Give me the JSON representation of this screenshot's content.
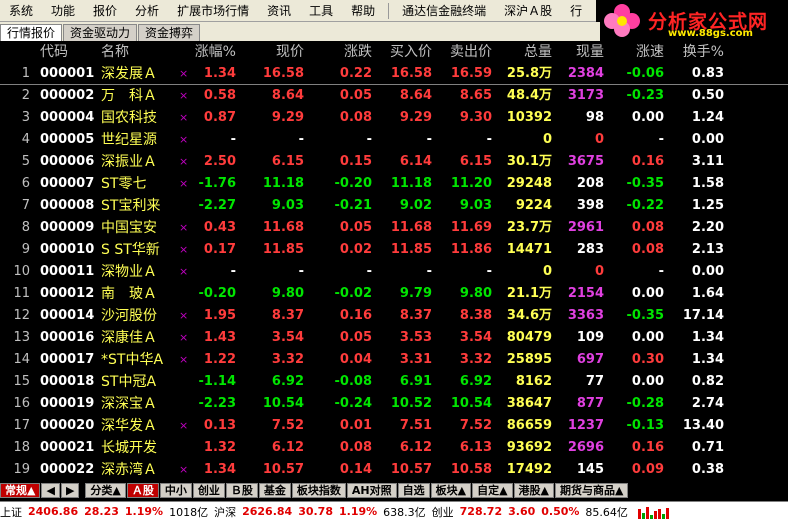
{
  "menu": {
    "items": [
      "系统",
      "功能",
      "报价",
      "分析",
      "扩展市场行情",
      "资讯",
      "工具",
      "帮助",
      "通达信金融终端",
      "深沪Ａ股",
      "行"
    ]
  },
  "logo": {
    "title": "分析家公式网",
    "url": "www.88gs.com"
  },
  "tabs": [
    "行情报价",
    "资金驱动力",
    "资金搏弈"
  ],
  "table": {
    "headers": {
      "code": "代码",
      "name": "名称",
      "pct": "涨幅%",
      "price": "现价",
      "chg": "涨跌",
      "bid": "买入价",
      "ask": "卖出价",
      "vol": "总量",
      "cur": "现量",
      "spd": "涨速",
      "turn": "换手%"
    },
    "rows": [
      {
        "idx": "1",
        "code": "000001",
        "name": "深发展Ａ",
        "mark": "×",
        "pct": "1.34",
        "price": "16.58",
        "chg": "0.22",
        "bid": "16.58",
        "ask": "16.59",
        "vol": "25.8万",
        "cur": "2384",
        "spd": "-0.06",
        "turn": "0.83",
        "dir": "up",
        "curc": "magenta",
        "spdd": "down"
      },
      {
        "idx": "2",
        "code": "000002",
        "name": "万　科Ａ",
        "mark": "×",
        "pct": "0.58",
        "price": "8.64",
        "chg": "0.05",
        "bid": "8.64",
        "ask": "8.65",
        "vol": "48.4万",
        "cur": "3173",
        "spd": "-0.23",
        "turn": "0.50",
        "dir": "up",
        "curc": "magenta",
        "spdd": "down"
      },
      {
        "idx": "3",
        "code": "000004",
        "name": "国农科技",
        "mark": "×",
        "pct": "0.87",
        "price": "9.29",
        "chg": "0.08",
        "bid": "9.29",
        "ask": "9.30",
        "vol": "10392",
        "cur": "98",
        "spd": "0.00",
        "turn": "1.24",
        "dir": "up",
        "curc": "white",
        "spdd": "flat"
      },
      {
        "idx": "4",
        "code": "000005",
        "name": "世纪星源",
        "mark": "×",
        "pct": "-",
        "price": "-",
        "chg": "-",
        "bid": "-",
        "ask": "-",
        "vol": "0",
        "cur": "0",
        "spd": "-",
        "turn": "0.00",
        "dir": "flat",
        "curc": "up",
        "spdd": "flat"
      },
      {
        "idx": "5",
        "code": "000006",
        "name": "深振业Ａ",
        "mark": "×",
        "pct": "2.50",
        "price": "6.15",
        "chg": "0.15",
        "bid": "6.14",
        "ask": "6.15",
        "vol": "30.1万",
        "cur": "3675",
        "spd": "0.16",
        "turn": "3.11",
        "dir": "up",
        "curc": "magenta",
        "spdd": "up"
      },
      {
        "idx": "6",
        "code": "000007",
        "name": "ST零七",
        "mark": "×",
        "pct": "-1.76",
        "price": "11.18",
        "chg": "-0.20",
        "bid": "11.18",
        "ask": "11.20",
        "vol": "29248",
        "cur": "208",
        "spd": "-0.35",
        "turn": "1.58",
        "dir": "down",
        "curc": "white",
        "spdd": "down"
      },
      {
        "idx": "7",
        "code": "000008",
        "name": "ST宝利来",
        "mark": "",
        "pct": "-2.27",
        "price": "9.03",
        "chg": "-0.21",
        "bid": "9.02",
        "ask": "9.03",
        "vol": "9224",
        "cur": "398",
        "spd": "-0.22",
        "turn": "1.25",
        "dir": "down",
        "curc": "white",
        "spdd": "down"
      },
      {
        "idx": "8",
        "code": "000009",
        "name": "中国宝安",
        "mark": "×",
        "pct": "0.43",
        "price": "11.68",
        "chg": "0.05",
        "bid": "11.68",
        "ask": "11.69",
        "vol": "23.7万",
        "cur": "2961",
        "spd": "0.08",
        "turn": "2.20",
        "dir": "up",
        "curc": "magenta",
        "spdd": "up"
      },
      {
        "idx": "9",
        "code": "000010",
        "name": "S ST华新",
        "mark": "×",
        "pct": "0.17",
        "price": "11.85",
        "chg": "0.02",
        "bid": "11.85",
        "ask": "11.86",
        "vol": "14471",
        "cur": "283",
        "spd": "0.08",
        "turn": "2.13",
        "dir": "up",
        "curc": "white",
        "spdd": "up"
      },
      {
        "idx": "10",
        "code": "000011",
        "name": "深物业Ａ",
        "mark": "×",
        "pct": "-",
        "price": "-",
        "chg": "-",
        "bid": "-",
        "ask": "-",
        "vol": "0",
        "cur": "0",
        "spd": "-",
        "turn": "0.00",
        "dir": "flat",
        "curc": "up",
        "spdd": "flat"
      },
      {
        "idx": "11",
        "code": "000012",
        "name": "南　玻Ａ",
        "mark": "",
        "pct": "-0.20",
        "price": "9.80",
        "chg": "-0.02",
        "bid": "9.79",
        "ask": "9.80",
        "vol": "21.1万",
        "cur": "2154",
        "spd": "0.00",
        "turn": "1.64",
        "dir": "down",
        "curc": "magenta",
        "spdd": "flat"
      },
      {
        "idx": "12",
        "code": "000014",
        "name": "沙河股份",
        "mark": "×",
        "pct": "1.95",
        "price": "8.37",
        "chg": "0.16",
        "bid": "8.37",
        "ask": "8.38",
        "vol": "34.6万",
        "cur": "3363",
        "spd": "-0.35",
        "turn": "17.14",
        "dir": "up",
        "curc": "magenta",
        "spdd": "down"
      },
      {
        "idx": "13",
        "code": "000016",
        "name": "深康佳Ａ",
        "mark": "×",
        "pct": "1.43",
        "price": "3.54",
        "chg": "0.05",
        "bid": "3.53",
        "ask": "3.54",
        "vol": "80479",
        "cur": "109",
        "spd": "0.00",
        "turn": "1.34",
        "dir": "up",
        "curc": "white",
        "spdd": "flat"
      },
      {
        "idx": "14",
        "code": "000017",
        "name": "*ST中华A",
        "mark": "×",
        "pct": "1.22",
        "price": "3.32",
        "chg": "0.04",
        "bid": "3.31",
        "ask": "3.32",
        "vol": "25895",
        "cur": "697",
        "spd": "0.30",
        "turn": "1.34",
        "dir": "up",
        "curc": "magenta",
        "spdd": "up"
      },
      {
        "idx": "15",
        "code": "000018",
        "name": "ST中冠A",
        "mark": "",
        "pct": "-1.14",
        "price": "6.92",
        "chg": "-0.08",
        "bid": "6.91",
        "ask": "6.92",
        "vol": "8162",
        "cur": "77",
        "spd": "0.00",
        "turn": "0.82",
        "dir": "down",
        "curc": "white",
        "spdd": "flat"
      },
      {
        "idx": "16",
        "code": "000019",
        "name": "深深宝Ａ",
        "mark": "",
        "pct": "-2.23",
        "price": "10.54",
        "chg": "-0.24",
        "bid": "10.52",
        "ask": "10.54",
        "vol": "38647",
        "cur": "877",
        "spd": "-0.28",
        "turn": "2.74",
        "dir": "down",
        "curc": "magenta",
        "spdd": "down"
      },
      {
        "idx": "17",
        "code": "000020",
        "name": "深华发Ａ",
        "mark": "×",
        "pct": "0.13",
        "price": "7.52",
        "chg": "0.01",
        "bid": "7.51",
        "ask": "7.52",
        "vol": "86659",
        "cur": "1237",
        "spd": "-0.13",
        "turn": "13.40",
        "dir": "up",
        "curc": "magenta",
        "spdd": "down"
      },
      {
        "idx": "18",
        "code": "000021",
        "name": "长城开发",
        "mark": "",
        "pct": "1.32",
        "price": "6.12",
        "chg": "0.08",
        "bid": "6.12",
        "ask": "6.13",
        "vol": "93692",
        "cur": "2696",
        "spd": "0.16",
        "turn": "0.71",
        "dir": "up",
        "curc": "magenta",
        "spdd": "up"
      },
      {
        "idx": "19",
        "code": "000022",
        "name": "深赤湾Ａ",
        "mark": "×",
        "pct": "1.34",
        "price": "10.57",
        "chg": "0.14",
        "bid": "10.57",
        "ask": "10.58",
        "vol": "17492",
        "cur": "145",
        "spd": "0.09",
        "turn": "0.38",
        "dir": "up",
        "curc": "white",
        "spdd": "up"
      }
    ]
  },
  "bottom_tabs": [
    "常规▲",
    "◀",
    "▶",
    "分类▲",
    "Ａ股",
    "中小",
    "创业",
    "Ｂ股",
    "基金",
    "板块指数",
    "AH对照",
    "自选",
    "板块▲",
    "自定▲",
    "港股▲",
    "期货与商品▲"
  ],
  "status": {
    "sh_label": "上证",
    "sh_index": "2406.86",
    "sh_chg": "28.23",
    "sh_pct": "1.19%",
    "sh_amt": "1018亿",
    "hs_label": "沪深",
    "hs_index": "2626.84",
    "hs_chg": "30.78",
    "hs_pct": "1.19%",
    "hs_amt": "638.3亿",
    "cy_label": "创业",
    "cy_index": "728.72",
    "cy_chg": "3.60",
    "cy_pct": "0.50%",
    "cy_amt": "85.64亿"
  },
  "colors": {
    "up": "#ff3c3c",
    "down": "#00e600",
    "background": "#000000",
    "code": "#ffffff",
    "name": "#ffff54"
  }
}
